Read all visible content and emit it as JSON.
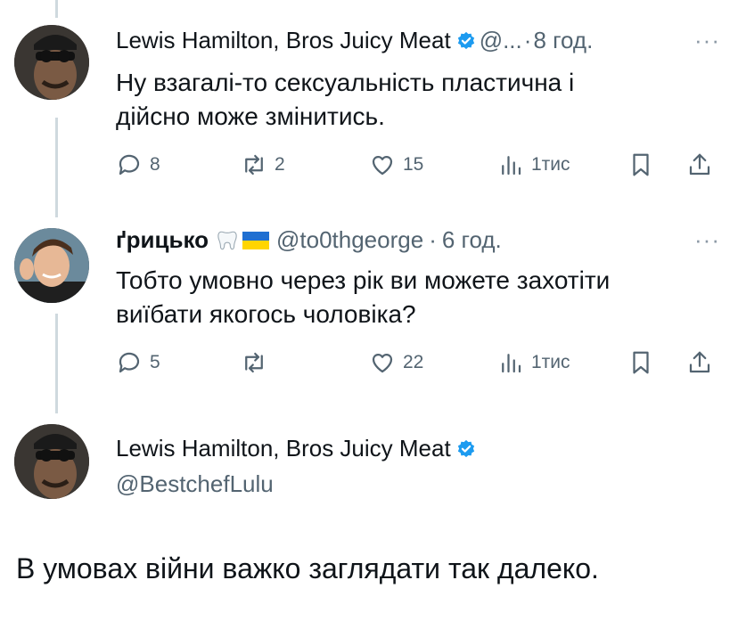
{
  "tweets": [
    {
      "name": "Lewis Hamilton, Bros Juicy Meat",
      "handle": "@...",
      "time": "8 год.",
      "text_line1": "Ну взагалі-то сексуальність пластична і",
      "text_line2": "дійсно може змінитись.",
      "replies": "8",
      "retweets": "2",
      "likes": "15",
      "views": "1тис"
    },
    {
      "name": "ґрицько",
      "handle": "@to0thgeorge",
      "time": "6 год.",
      "text_line1": "Тобто умовно через рік ви можете захотіти",
      "text_line2": "виїбати якогось чоловіка?",
      "replies": "5",
      "retweets": "",
      "likes": "22",
      "views": "1тис"
    }
  ],
  "main_tweet": {
    "name": "Lewis Hamilton, Bros Juicy Meat",
    "handle": "@BestchefLulu",
    "text": "В умовах війни важко заглядати так далеко."
  },
  "more_glyph": "···",
  "separator": "·",
  "colors": {
    "verified": "#1d9bf0",
    "muted": "#536471",
    "text": "#0f1419",
    "line": "#cfd9de"
  },
  "icons": [
    "reply-icon",
    "retweet-icon",
    "like-icon",
    "views-icon",
    "bookmark-icon",
    "share-icon",
    "verified-icon",
    "tooth-icon",
    "flag-icon"
  ]
}
